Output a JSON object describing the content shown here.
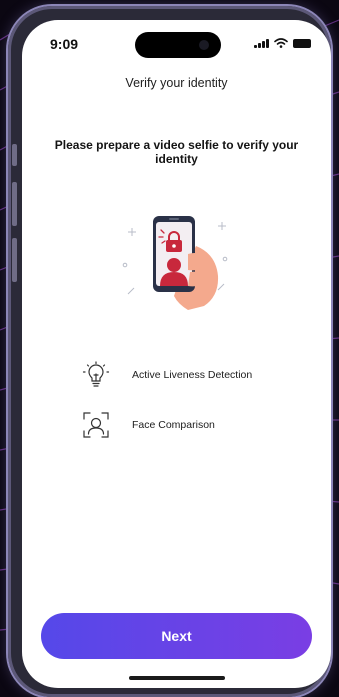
{
  "status_bar": {
    "time": "9:09",
    "icons": [
      "signal-icon",
      "wifi-icon",
      "battery-icon"
    ]
  },
  "screen": {
    "title": "Verify your identity",
    "headline": "Please prepare a video selfie to verify your identity",
    "illustration": "hand-holding-phone-with-face-and-lock-illustration"
  },
  "features": [
    {
      "label": "Active Liveness Detection",
      "icon": "lightbulb-icon"
    },
    {
      "label": "Face Comparison",
      "icon": "face-scan-icon"
    }
  ],
  "actions": {
    "next_label": "Next"
  },
  "colors": {
    "button_gradient_start": "#5548e9",
    "button_gradient_end": "#7a3ee4",
    "accent_red": "#c8283c",
    "device_frame": "#2b2a38"
  }
}
